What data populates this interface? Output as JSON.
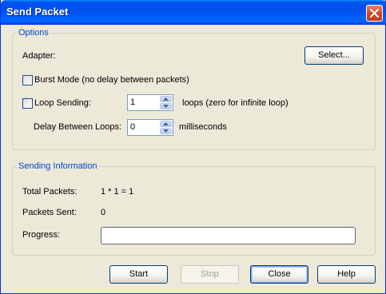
{
  "window": {
    "title": "Send Packet"
  },
  "options": {
    "legend": "Options",
    "adapter_label": "Adapter:",
    "select_button": "Select...",
    "burst_mode": {
      "label": "Burst Mode (no delay between packets)",
      "checked": false
    },
    "loop_sending": {
      "label": "Loop Sending:",
      "checked": false
    },
    "loops_value": "1",
    "loops_suffix": "loops (zero for infinite loop)",
    "delay_label": "Delay Between Loops:",
    "delay_value": "0",
    "delay_suffix": "milliseconds"
  },
  "sending_info": {
    "legend": "Sending Information",
    "total_packets_label": "Total Packets:",
    "total_packets_value": "1 * 1 = 1",
    "packets_sent_label": "Packets Sent:",
    "packets_sent_value": "0",
    "progress_label": "Progress:",
    "progress_fraction": 0
  },
  "buttons": {
    "start": "Start",
    "stop": "Stop",
    "close": "Close",
    "help": "Help"
  },
  "colors": {
    "titlebar": "#0054e3",
    "group_legend": "#0046d5",
    "dialog_bg": "#ece9d8"
  }
}
